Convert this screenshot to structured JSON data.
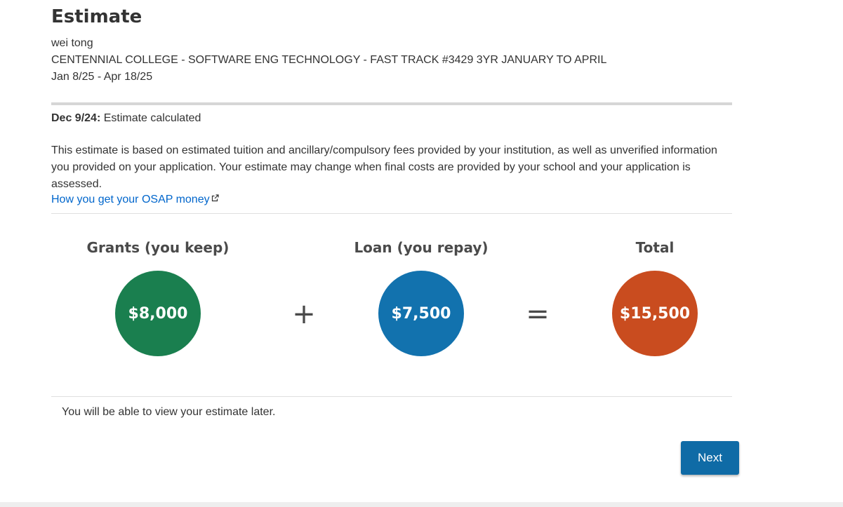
{
  "page": {
    "title": "Estimate",
    "student_name": "wei tong",
    "program": "CENTENNIAL COLLEGE - SOFTWARE ENG TECHNOLOGY - FAST TRACK #3429 3YR JANUARY TO APRIL",
    "study_period": "Jan 8/25 - Apr 18/25"
  },
  "calculation": {
    "date": "Dec 9/24:",
    "status": " Estimate calculated"
  },
  "description": "This estimate is based on estimated tuition and ancillary/compulsory fees provided by your institution, as well as unverified information you provided on your application. Your estimate may change when final costs are provided by your school and your application is assessed.",
  "osap_link": {
    "label": "How you get your OSAP money",
    "icon": "external-link-icon"
  },
  "breakdown": {
    "grants": {
      "label": "Grants (you keep)",
      "amount": "$8,000",
      "color": "#1a7f4f"
    },
    "plus": "+",
    "loan": {
      "label": "Loan (you repay)",
      "amount": "$7,500",
      "color": "#1272ae"
    },
    "equals": "=",
    "total": {
      "label": "Total",
      "amount": "$15,500",
      "color": "#c94c1f"
    }
  },
  "footer_note": "You will be able to view your estimate later.",
  "next_button": "Next"
}
